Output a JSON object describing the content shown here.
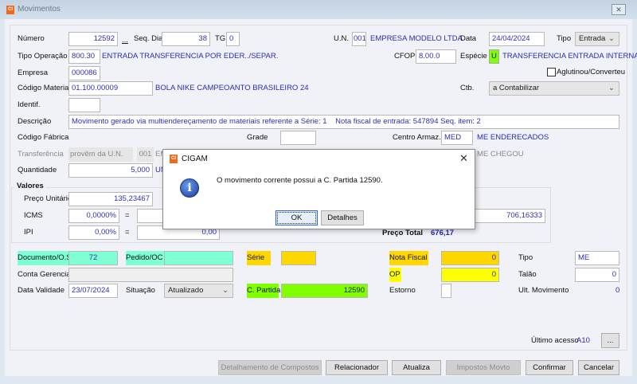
{
  "window": {
    "title": "Movimentos",
    "close": "✕"
  },
  "form": {
    "numero": {
      "label": "Número",
      "value": "12592",
      "lookup": "..."
    },
    "seq_dia": {
      "label": "Seq. Dia",
      "value": "38"
    },
    "tg": {
      "label": "TG",
      "value": "0"
    },
    "un": {
      "label": "U.N.",
      "value": "001",
      "desc": "EMPRESA MODELO LTDA"
    },
    "data": {
      "label": "Data",
      "value": "24/04/2024"
    },
    "tipo": {
      "label": "Tipo",
      "value": "Entrada"
    },
    "tipo_operacao": {
      "label": "Tipo Operação",
      "value": "800.30",
      "desc": "ENTRADA TRANSFERENCIA POR EDER../SEPAR."
    },
    "cfop": {
      "label": "CFOP",
      "value": "8.00.0"
    },
    "especie": {
      "label": "Espécie",
      "value": "U",
      "desc": "TRANSFERENCIA ENTRADA INTERNA"
    },
    "empresa": {
      "label": "Empresa",
      "value": "000086"
    },
    "aglutinou": {
      "label": "Aglutinou/Converteu",
      "checked": false
    },
    "codigo_material": {
      "label": "Código Material",
      "value": "01.100.00009",
      "desc": "BOLA NIKE CAMPEOANTO BRASILEIRO 24"
    },
    "ctb": {
      "label": "Ctb.",
      "value": "a Contabilizar"
    },
    "identif": {
      "label": "Identif.",
      "value": ""
    },
    "descricao": {
      "label": "Descrição",
      "value": "Movimento gerado via multiendereçamento de materiais referente a Série: 1    Nota fiscal de entrada: 547894 Seq. item: 2"
    },
    "codigo_fabrica": {
      "label": "Código Fábrica"
    },
    "grade": {
      "label": "Grade",
      "value": ""
    },
    "centro_armaz": {
      "label": "Centro Armaz.",
      "value": "MED",
      "desc": "ME ENDERECADOS"
    },
    "transferencia": {
      "label": "Transferência",
      "provem": "provêm da U.N.",
      "un": "001",
      "desc": "EM",
      "dest": "ME CHEGOU"
    },
    "quantidade": {
      "label": "Quantidade",
      "value": "5,000",
      "unit": "UN"
    }
  },
  "valores": {
    "title": "Valores",
    "preco_unitario": {
      "label": "Preço Unitário",
      "value": "135,23467"
    },
    "icms": {
      "label": "ICMS",
      "pct": "0,0000%",
      "eq": "=",
      "value": ""
    },
    "ipi": {
      "label": "IPI",
      "pct": "0,00%",
      "eq": "=",
      "value": "0,00"
    },
    "other_value": "706,16333",
    "preco_total": {
      "label": "Preço Total",
      "value": "676,17"
    }
  },
  "bottom": {
    "documento": {
      "label": "Documento/O.S",
      "value": "72"
    },
    "pedido": {
      "label": "Pedido/OC",
      "value": ""
    },
    "serie": {
      "label": "Série",
      "value": ""
    },
    "nota_fiscal": {
      "label": "Nota Fiscal",
      "value": "0"
    },
    "tipo": {
      "label": "Tipo",
      "value": "ME"
    },
    "conta_gerencial": {
      "label": "Conta Gerencial",
      "value": ""
    },
    "op": {
      "label": "OP",
      "value": "0"
    },
    "talao": {
      "label": "Talão",
      "value": "0"
    },
    "data_validade": {
      "label": "Data Validade",
      "value": "23/07/2024"
    },
    "situacao": {
      "label": "Situação",
      "value": "Atualizado"
    },
    "c_partida": {
      "label": "C. Partida",
      "value": "12590"
    },
    "estorno": {
      "label": "Estorno"
    },
    "ult_movimento": {
      "label": "Ult. Movimento",
      "value": "0"
    },
    "ultimo_acesso": {
      "label": "Último acesso",
      "value": "A10",
      "button": "..."
    }
  },
  "buttons": {
    "detalhamento": "Detalhamento de Compostos",
    "relacionador": "Relacionador",
    "atualiza": "Atualiza",
    "impostos": "Impostos Movto",
    "confirmar": "Confirmar",
    "cancelar": "Cancelar"
  },
  "dialog": {
    "title": "CIGAM",
    "close": "✕",
    "message": "O movimento corrente possui a C. Partida 12590.",
    "ok": "OK",
    "detalhes": "Detalhes"
  },
  "colors": {
    "aqua": "#7fffd4",
    "gold": "#ffd700",
    "yellow": "#ffff00",
    "lime": "#7fff00"
  }
}
